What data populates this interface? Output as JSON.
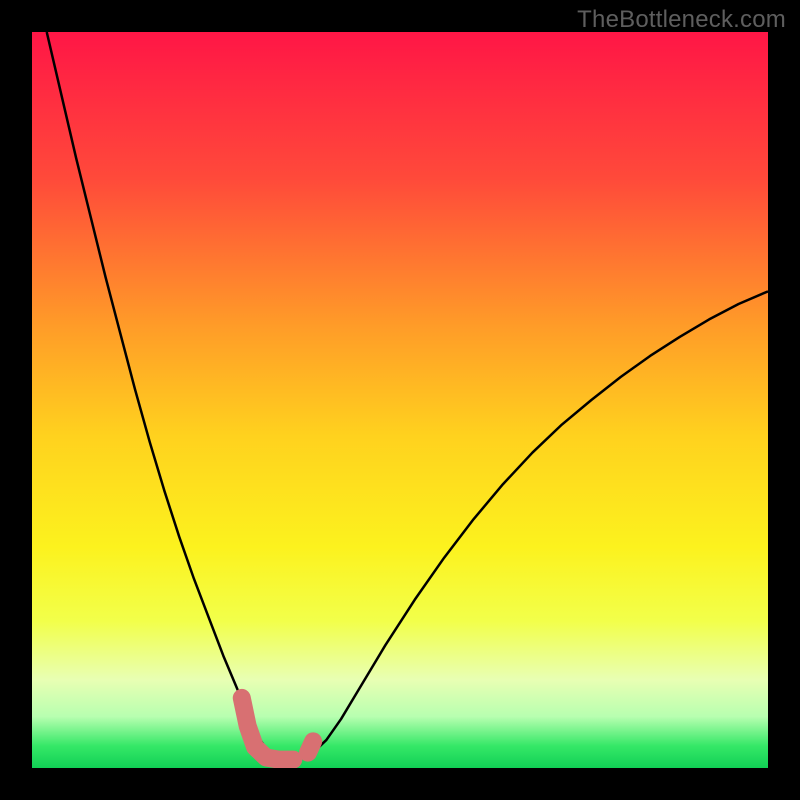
{
  "watermark": "TheBottleneck.com",
  "chart_data": {
    "type": "line",
    "title": "",
    "xlabel": "",
    "ylabel": "",
    "xlim": [
      0,
      100
    ],
    "ylim": [
      0,
      105
    ],
    "background_gradient": {
      "stops": [
        {
          "offset": 0.0,
          "color": "#ff1646"
        },
        {
          "offset": 0.2,
          "color": "#ff4a3a"
        },
        {
          "offset": 0.4,
          "color": "#ff9c28"
        },
        {
          "offset": 0.55,
          "color": "#ffd21e"
        },
        {
          "offset": 0.7,
          "color": "#fcf21e"
        },
        {
          "offset": 0.8,
          "color": "#f2ff4a"
        },
        {
          "offset": 0.88,
          "color": "#e8ffb3"
        },
        {
          "offset": 0.93,
          "color": "#b8ffb0"
        },
        {
          "offset": 0.97,
          "color": "#35e867"
        },
        {
          "offset": 1.0,
          "color": "#11d055"
        }
      ]
    },
    "series": [
      {
        "name": "bottleneck-curve",
        "color": "#000000",
        "stroke_width": 2.5,
        "x": [
          2,
          4,
          6,
          8,
          10,
          12,
          14,
          16,
          18,
          20,
          22,
          24,
          26,
          27,
          28,
          29,
          30,
          31,
          32,
          33,
          34,
          36,
          38,
          40,
          42,
          44,
          46,
          48,
          52,
          56,
          60,
          64,
          68,
          72,
          76,
          80,
          84,
          88,
          92,
          96,
          100
        ],
        "y": [
          105,
          96,
          87,
          78.5,
          70,
          62,
          54,
          46.5,
          39.5,
          33,
          27,
          21.5,
          16,
          13.5,
          11,
          8.5,
          6,
          4,
          2.5,
          1.5,
          1.2,
          1.2,
          2,
          4,
          7,
          10.5,
          14,
          17.5,
          24,
          30,
          35.5,
          40.5,
          45,
          49,
          52.5,
          55.8,
          58.8,
          61.5,
          64,
          66.2,
          68
        ]
      }
    ],
    "highlight": {
      "slug_color": "#d87072",
      "stroke_width": 18,
      "points_xy": [
        [
          28.5,
          10.0
        ],
        [
          29.3,
          6.0
        ],
        [
          30.3,
          3.0
        ],
        [
          31.8,
          1.5
        ],
        [
          33.5,
          1.2
        ],
        [
          35.5,
          1.2
        ]
      ],
      "right_cap_xy": [
        [
          37.5,
          2.2
        ],
        [
          38.2,
          3.8
        ]
      ]
    }
  }
}
